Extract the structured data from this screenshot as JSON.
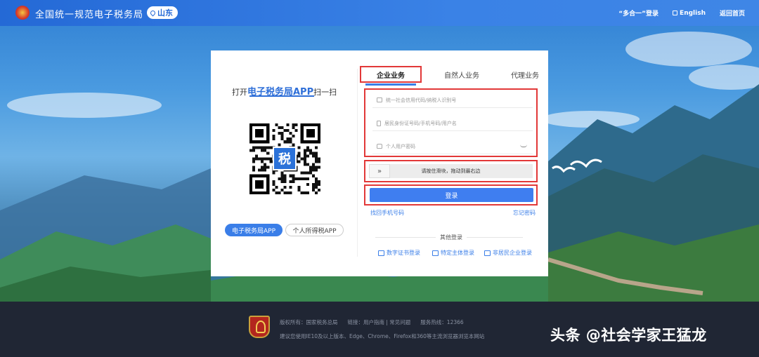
{
  "header": {
    "site_title": "全国统一规范电子税务局",
    "region": "山东",
    "links": [
      "“多合一”登录",
      "English",
      "返回首页"
    ]
  },
  "card": {
    "qr_prefix": "打开",
    "qr_app": "电子税务局APP",
    "qr_suffix": "扫一扫",
    "qr_center_char": "税",
    "app_buttons": [
      "电子税务局APP",
      "个人所得税APP"
    ],
    "tabs": [
      "企业业务",
      "自然人业务",
      "代理业务"
    ],
    "active_tab": "企业业务",
    "fields": [
      {
        "placeholder": "统一社会信用代码/纳税人识别号",
        "icon": "id-card-icon"
      },
      {
        "placeholder": "居民身份证号码/手机号码/用户名",
        "icon": "phone-icon"
      },
      {
        "placeholder": "个人用户密码",
        "icon": "lock-icon"
      }
    ],
    "slider_text": "请按住滑块，拖动到最右边",
    "slider_knob": "»",
    "login_label": "登录",
    "link_left": "找回手机号码",
    "link_right": "忘记密码",
    "other_label": "其他登录",
    "other_options": [
      "数字证书登录",
      "特定主体登录",
      "非居民企业登录"
    ]
  },
  "footer": {
    "row1": [
      "版权所有：国家税务总局",
      "链接：用户指南 | 常见问题",
      "服务热线：12366"
    ],
    "row2": "建议您使用IE10及以上版本、Edge、Chrome、Firefox和360等主流浏览器浏览本网站"
  },
  "watermark": "头条 @社会学家王猛龙",
  "colors": {
    "primary": "#3a7ee8",
    "highlight": "#e23838",
    "footer": "#202634"
  }
}
